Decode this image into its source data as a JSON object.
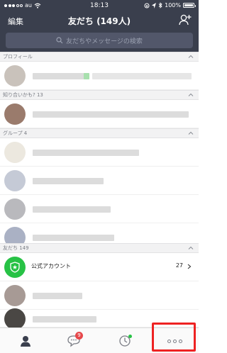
{
  "status_bar": {
    "carrier": "au",
    "time": "18:13",
    "battery": "100%"
  },
  "nav": {
    "edit_label": "編集",
    "title": "友だち (149人)"
  },
  "search": {
    "placeholder": "友だちやメッセージの検索"
  },
  "sections": {
    "profile": {
      "label": "プロフィール"
    },
    "suggested": {
      "label": "知り合いかも? 13"
    },
    "groups": {
      "label": "グループ 4"
    },
    "friends": {
      "label": "友だち 149"
    }
  },
  "official_accounts": {
    "label": "公式アカウント",
    "count": "27"
  },
  "tabbar": {
    "chats_badge": "9"
  },
  "colors": {
    "header_bg": "#3a3f4d",
    "accent_green": "#27c245",
    "badge_red": "#e6484b",
    "highlight_red": "#ee2222"
  }
}
